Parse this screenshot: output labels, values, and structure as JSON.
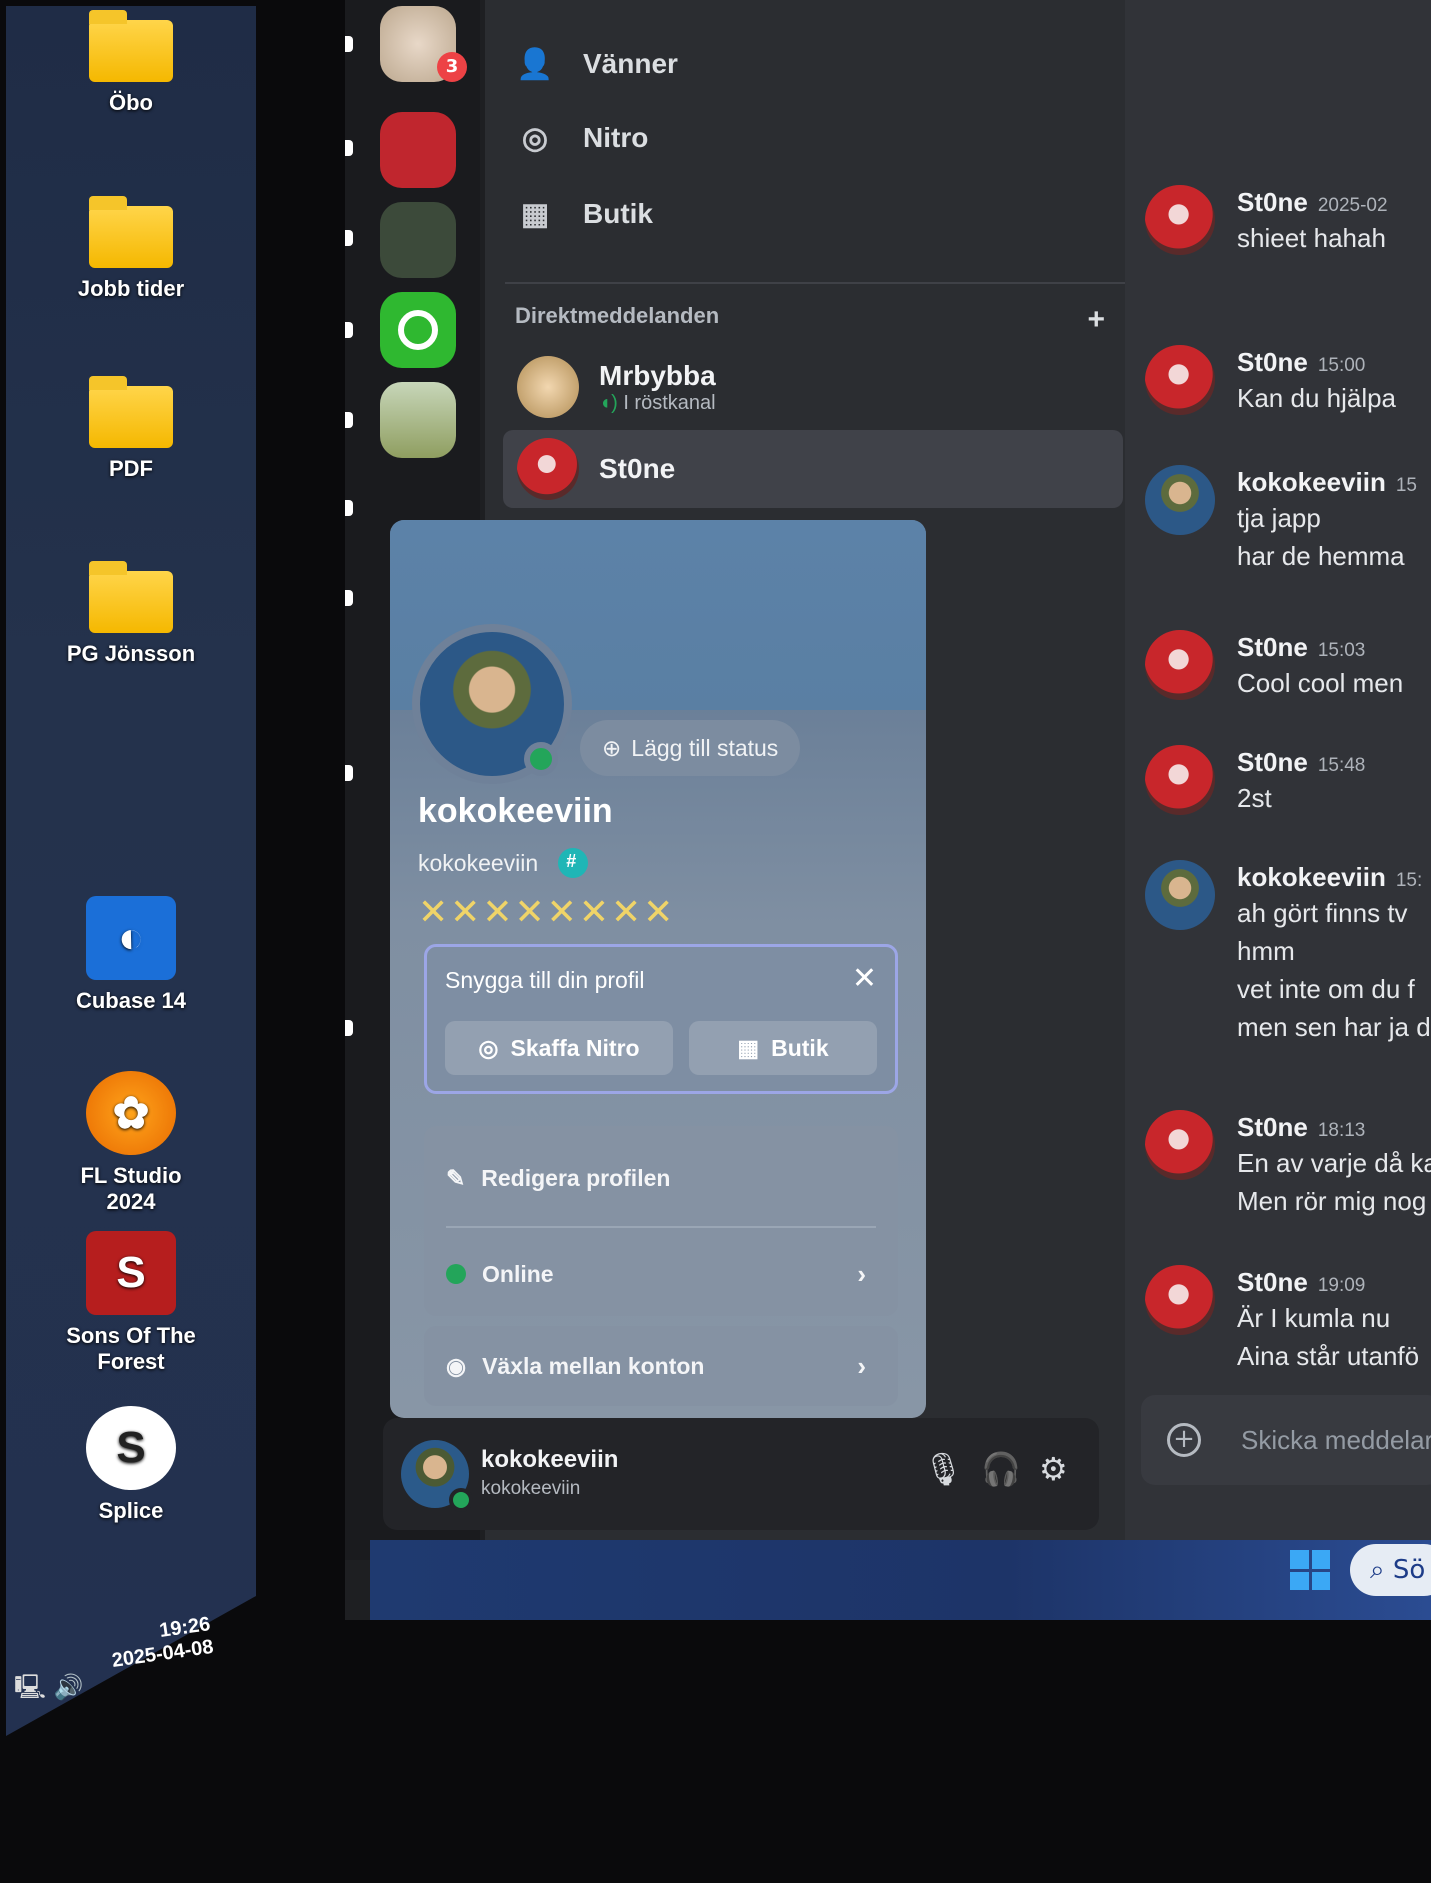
{
  "desktop": {
    "icons": [
      {
        "label": "Öbo",
        "kind": "folder-icon"
      },
      {
        "label": "Jobb tider",
        "kind": "folder-icon"
      },
      {
        "label": "PDF",
        "kind": "folder-icon"
      },
      {
        "label": "PG Jönsson",
        "kind": "folder-icon"
      },
      {
        "label": "Cubase 14",
        "kind": "cubase-icon"
      },
      {
        "label": "FL Studio 2024",
        "kind": "fl-studio-icon"
      },
      {
        "label": "Sons Of The Forest",
        "kind": "game-icon"
      },
      {
        "label": "Splice",
        "kind": "splice-icon"
      }
    ],
    "clock_time": "19:26",
    "clock_date": "2025-04-08"
  },
  "servers": {
    "badge_count": "3",
    "items": [
      "server-1",
      "game-chill",
      "server-3",
      "xbox",
      "server-5",
      "server-6"
    ]
  },
  "nav": {
    "friends": "Vänner",
    "nitro": "Nitro",
    "shop": "Butik"
  },
  "dm": {
    "header": "Direktmeddelanden",
    "add": "+",
    "items": [
      {
        "name": "Mrbybba",
        "sub": "I röstkanal"
      },
      {
        "name": "St0ne"
      }
    ]
  },
  "profile": {
    "display_name": "kokokeeviin",
    "username": "kokokeeviin",
    "status_button": "Lägg till status",
    "pronoun_marks": "✕✕✕✕✕✕✕✕",
    "promo_title": "Snygga till din profil",
    "promo_close": "✕",
    "nitro_button": "Skaffa Nitro",
    "shop_button": "Butik",
    "edit_profile": "Redigera profilen",
    "status_online": "Online",
    "switch_accounts": "Växla mellan konton"
  },
  "user_panel": {
    "name": "kokokeeviin",
    "handle": "kokokeeviin"
  },
  "chat": {
    "messages": [
      {
        "author": "St0ne",
        "time": "2025-02",
        "lines": [
          "shieet hahah"
        ],
        "avatar": "stone"
      },
      {
        "author": "St0ne",
        "time": "15:00",
        "lines": [
          "Kan du hjälpa"
        ],
        "avatar": "stone"
      },
      {
        "author": "kokokeeviin",
        "time": "15",
        "lines": [
          "tja japp",
          "har de hemma"
        ],
        "avatar": "koko"
      },
      {
        "author": "St0ne",
        "time": "15:03",
        "lines": [
          "Cool cool men"
        ],
        "avatar": "stone"
      },
      {
        "author": "St0ne",
        "time": "15:48",
        "lines": [
          "2st"
        ],
        "avatar": "stone"
      },
      {
        "author": "kokokeeviin",
        "time": "15:",
        "lines": [
          "ah gört finns tv",
          "hmm",
          "vet inte om du f",
          "men sen har ja d"
        ],
        "avatar": "koko"
      },
      {
        "author": "St0ne",
        "time": "18:13",
        "lines": [
          "En av varje då ka",
          "Men rör mig nog"
        ],
        "avatar": "stone"
      },
      {
        "author": "St0ne",
        "time": "19:09",
        "lines": [
          "Är I kumla nu",
          "Aina står utanfö"
        ],
        "avatar": "stone"
      }
    ],
    "composer_placeholder": "Skicka meddelar"
  },
  "taskbar": {
    "search_label": "Sö"
  },
  "colors": {
    "online": "#23a55a",
    "badge_red": "#ed4245",
    "xbox_green": "#2fb830"
  }
}
